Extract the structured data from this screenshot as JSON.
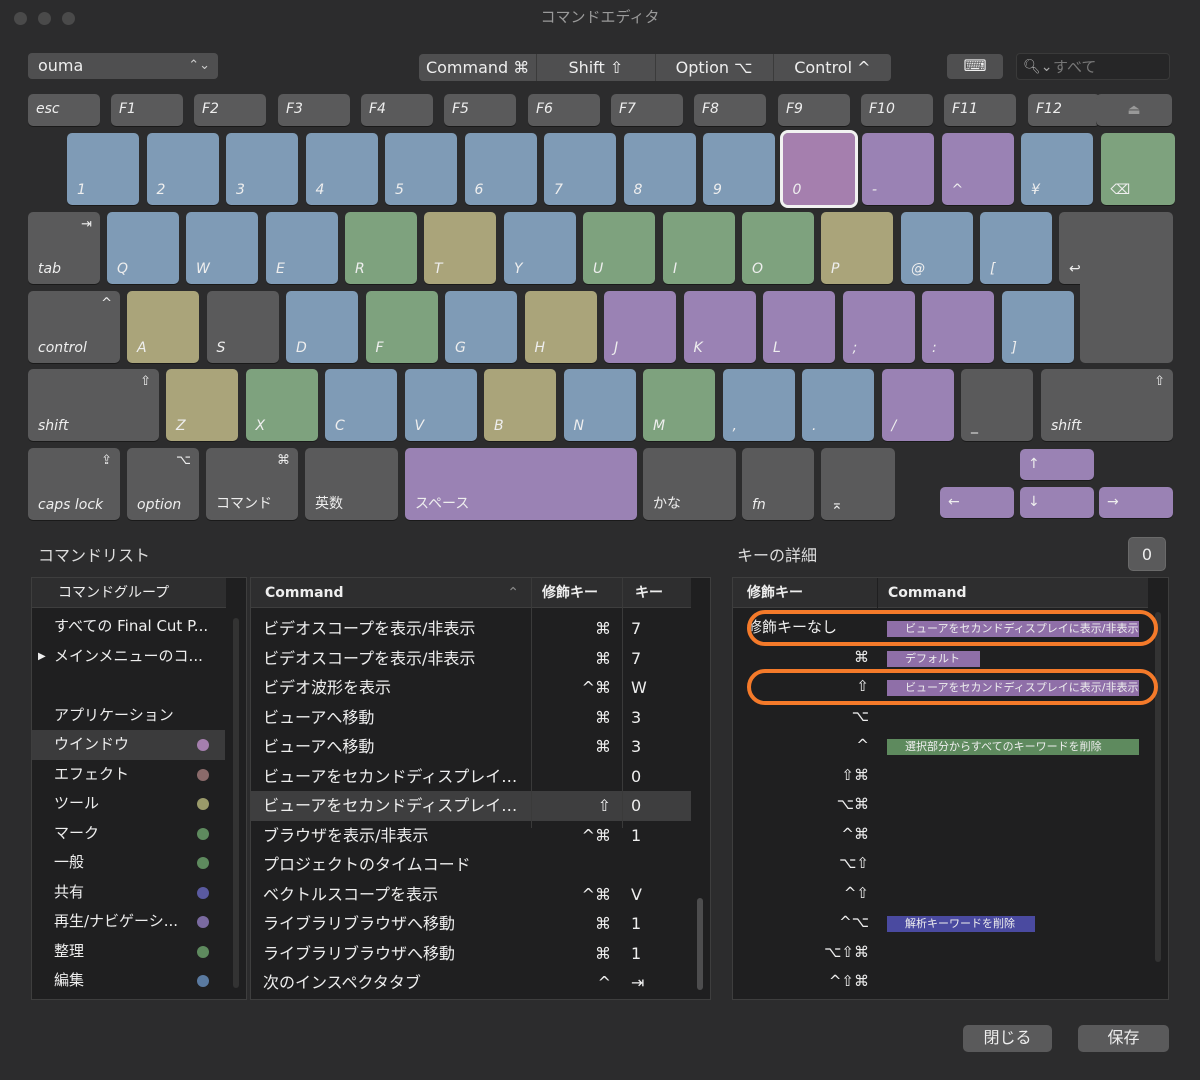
{
  "window": {
    "title": "コマンドエディタ"
  },
  "toolbar": {
    "preset": "ouma",
    "modifiers": [
      "Command ⌘",
      "Shift ⇧",
      "Option ⌥",
      "Control ^"
    ],
    "keyboard_button_icon": "⌨",
    "search_placeholder": "すべて"
  },
  "keyboard": {
    "fkeys": [
      "esc",
      "F1",
      "F2",
      "F3",
      "F4",
      "F5",
      "F6",
      "F7",
      "F8",
      "F9",
      "F10",
      "F11",
      "F12",
      "⏏"
    ],
    "row1": [
      {
        "l": "1",
        "c": "b"
      },
      {
        "l": "2",
        "c": "b"
      },
      {
        "l": "3",
        "c": "b"
      },
      {
        "l": "4",
        "c": "b"
      },
      {
        "l": "5",
        "c": "b"
      },
      {
        "l": "6",
        "c": "b"
      },
      {
        "l": "7",
        "c": "b"
      },
      {
        "l": "8",
        "c": "b"
      },
      {
        "l": "9",
        "c": "b"
      },
      {
        "l": "0",
        "c": "m"
      },
      {
        "l": "-",
        "c": "p"
      },
      {
        "l": "^",
        "c": "p"
      },
      {
        "l": "¥",
        "c": "b"
      },
      {
        "l": "⌫",
        "c": "g"
      }
    ],
    "row2": [
      {
        "l": "tab",
        "c": "gr",
        "s": "⇥"
      },
      {
        "l": "Q",
        "c": "b"
      },
      {
        "l": "W",
        "c": "b"
      },
      {
        "l": "E",
        "c": "b"
      },
      {
        "l": "R",
        "c": "g"
      },
      {
        "l": "T",
        "c": "y"
      },
      {
        "l": "Y",
        "c": "b"
      },
      {
        "l": "U",
        "c": "g"
      },
      {
        "l": "I",
        "c": "g"
      },
      {
        "l": "O",
        "c": "g"
      },
      {
        "l": "P",
        "c": "y"
      },
      {
        "l": "@",
        "c": "b"
      },
      {
        "l": "[",
        "c": "b"
      },
      {
        "l": "↩",
        "c": "gr"
      }
    ],
    "row3": [
      {
        "l": "control",
        "c": "gr",
        "s": "^"
      },
      {
        "l": "A",
        "c": "y"
      },
      {
        "l": "S",
        "c": "gr"
      },
      {
        "l": "D",
        "c": "b"
      },
      {
        "l": "F",
        "c": "g"
      },
      {
        "l": "G",
        "c": "b"
      },
      {
        "l": "H",
        "c": "y"
      },
      {
        "l": "J",
        "c": "p"
      },
      {
        "l": "K",
        "c": "p"
      },
      {
        "l": "L",
        "c": "p"
      },
      {
        "l": ";",
        "c": "p"
      },
      {
        "l": ":",
        "c": "p"
      },
      {
        "l": "]",
        "c": "b"
      }
    ],
    "row4": [
      {
        "l": "shift",
        "c": "gr",
        "s": "⇧"
      },
      {
        "l": "Z",
        "c": "y"
      },
      {
        "l": "X",
        "c": "g"
      },
      {
        "l": "C",
        "c": "b"
      },
      {
        "l": "V",
        "c": "b"
      },
      {
        "l": "B",
        "c": "y"
      },
      {
        "l": "N",
        "c": "b"
      },
      {
        "l": "M",
        "c": "g"
      },
      {
        "l": ",",
        "c": "b"
      },
      {
        "l": ".",
        "c": "b"
      },
      {
        "l": "/",
        "c": "p"
      },
      {
        "l": "_",
        "c": "gr"
      },
      {
        "l": "shift",
        "c": "gr",
        "s": "⇧"
      }
    ],
    "row5": [
      {
        "l": "caps lock",
        "c": "gr",
        "s": "⇪"
      },
      {
        "l": "option",
        "c": "gr",
        "s": "⌥"
      },
      {
        "l": "コマンド",
        "c": "gr",
        "s": "⌘"
      },
      {
        "l": "英数",
        "c": "gr"
      },
      {
        "l": "スペース",
        "c": "p"
      },
      {
        "l": "かな",
        "c": "gr"
      },
      {
        "l": "fn",
        "c": "gr"
      },
      {
        "l": "⌅",
        "c": "gr"
      }
    ],
    "arrows": {
      "up": "↑",
      "left": "←",
      "down": "↓",
      "right": "→"
    }
  },
  "command_list": {
    "title": "コマンドリスト",
    "group_header": "コマンドグループ",
    "groups": [
      {
        "label": "すべての Final Cut P...",
        "dot": ""
      },
      {
        "label": "メインメニューのコ...",
        "dot": "",
        "arrow": "▶"
      },
      {
        "label": "",
        "dot": ""
      },
      {
        "label": "アプリケーション",
        "dot": ""
      },
      {
        "label": "ウインドウ",
        "dot": "#a57fae"
      },
      {
        "label": "エフェクト",
        "dot": "#8a6a6a"
      },
      {
        "label": "ツール",
        "dot": "#9a9a6a"
      },
      {
        "label": "マーク",
        "dot": "#5e8a5e"
      },
      {
        "label": "一般",
        "dot": "#5e8a5e"
      },
      {
        "label": "共有",
        "dot": "#5a5aa0"
      },
      {
        "label": "再生/ナビゲーシ...",
        "dot": "#7a6aa0"
      },
      {
        "label": "整理",
        "dot": "#5e8a5e"
      },
      {
        "label": "編集",
        "dot": "#5a7aa0"
      }
    ],
    "headers": {
      "command": "Command",
      "modifier": "修飾キー",
      "key": "キー",
      "sort_icon": "⌃"
    },
    "rows": [
      {
        "cmd": "ビデオスコープを表示/非表示",
        "mod": "⌘",
        "key": "7"
      },
      {
        "cmd": "ビデオスコープを表示/非表示",
        "mod": "⌘",
        "key": "7"
      },
      {
        "cmd": "ビデオ波形を表示",
        "mod": "^⌘",
        "key": "W"
      },
      {
        "cmd": "ビューアへ移動",
        "mod": "⌘",
        "key": "3"
      },
      {
        "cmd": "ビューアへ移動",
        "mod": "⌘",
        "key": "3"
      },
      {
        "cmd": "ビューアをセカンドディスプレイ…",
        "mod": "",
        "key": "0"
      },
      {
        "cmd": "ビューアをセカンドディスプレイ…",
        "mod": "⇧",
        "key": "0"
      },
      {
        "cmd": "ブラウザを表示/非表示",
        "mod": "^⌘",
        "key": "1"
      },
      {
        "cmd": "プロジェクトのタイムコード",
        "mod": "",
        "key": ""
      },
      {
        "cmd": "ベクトルスコープを表示",
        "mod": "^⌘",
        "key": "V"
      },
      {
        "cmd": "ライブラリブラウザへ移動",
        "mod": "⌘",
        "key": "1"
      },
      {
        "cmd": "ライブラリブラウザへ移動",
        "mod": "⌘",
        "key": "1"
      },
      {
        "cmd": "次のインスペクタタブ",
        "mod": "^",
        "key": "⇥"
      }
    ]
  },
  "key_detail": {
    "title": "キーの詳細",
    "key_badge": "0",
    "headers": {
      "modifier": "修飾キー",
      "command": "Command"
    },
    "rows": [
      {
        "mod": "修飾キーなし",
        "cmd": "ビューアをセカンドディスプレイに表示/非表示",
        "color": "#8f6fa8"
      },
      {
        "mod": "⌘",
        "cmd": "デフォルト",
        "color": "#8f6fa8"
      },
      {
        "mod": "⇧",
        "cmd": "ビューアをセカンドディスプレイに表示/非表示",
        "color": "#8f6fa8"
      },
      {
        "mod": "⌥",
        "cmd": "",
        "color": ""
      },
      {
        "mod": "^",
        "cmd": "選択部分からすべてのキーワードを削除",
        "color": "#5e8a5e"
      },
      {
        "mod": "⇧⌘",
        "cmd": "",
        "color": ""
      },
      {
        "mod": "⌥⌘",
        "cmd": "",
        "color": ""
      },
      {
        "mod": "^⌘",
        "cmd": "",
        "color": ""
      },
      {
        "mod": "⌥⇧",
        "cmd": "",
        "color": ""
      },
      {
        "mod": "^⇧",
        "cmd": "",
        "color": ""
      },
      {
        "mod": "^⌥",
        "cmd": "解析キーワードを削除",
        "color": "#4a4aa0"
      },
      {
        "mod": "⌥⇧⌘",
        "cmd": "",
        "color": ""
      },
      {
        "mod": "^⇧⌘",
        "cmd": "",
        "color": ""
      }
    ]
  },
  "footer": {
    "close": "閉じる",
    "save": "保存"
  }
}
